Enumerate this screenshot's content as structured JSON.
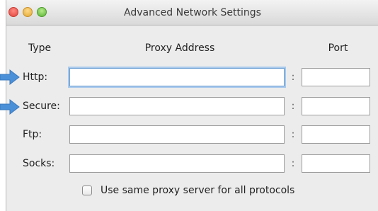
{
  "window": {
    "title": "Advanced Network Settings"
  },
  "columns": {
    "type": "Type",
    "proxy_address": "Proxy Address",
    "port": "Port"
  },
  "rows": [
    {
      "label": "Http:",
      "address": "",
      "port": "",
      "focused": true
    },
    {
      "label": "Secure:",
      "address": "",
      "port": "",
      "focused": false
    },
    {
      "label": "Ftp:",
      "address": "",
      "port": "",
      "focused": false
    },
    {
      "label": "Socks:",
      "address": "",
      "port": "",
      "focused": false
    }
  ],
  "separator": ":",
  "same_proxy": {
    "label": "Use same proxy server for all protocols",
    "checked": false
  },
  "colors": {
    "arrow": "#4a90d9",
    "focus_ring": "#a9c9ec"
  },
  "icons": [
    "close-icon",
    "minimize-icon",
    "zoom-icon",
    "arrow-right-icon"
  ]
}
